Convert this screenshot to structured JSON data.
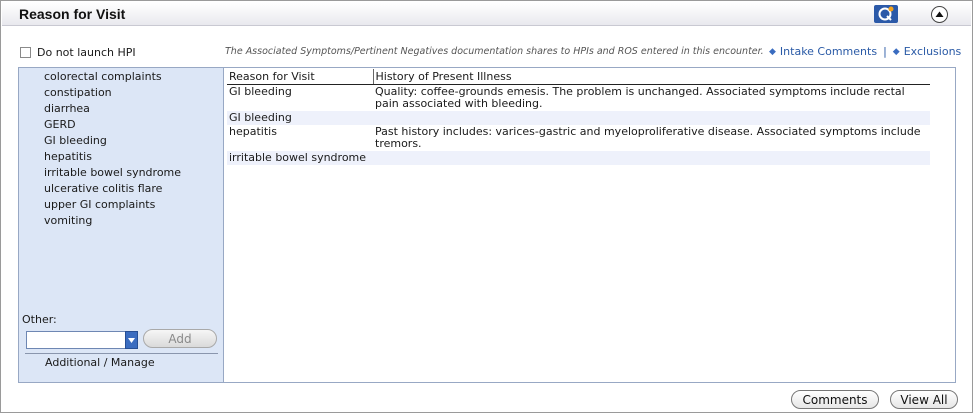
{
  "window": {
    "title": "Reason for Visit"
  },
  "options": {
    "do_not_launch_hpi_label": "Do not launch HPI",
    "note": "The Associated Symptoms/Pertinent Negatives documentation shares to HPIs and ROS entered in this encounter.",
    "intake_comments_label": "Intake Comments",
    "separator": "|",
    "exclusions_label": "Exclusions"
  },
  "left_panel": {
    "complaints": [
      "colorectal complaints",
      "constipation",
      "diarrhea",
      "GERD",
      "GI bleeding",
      "hepatitis",
      "irritable bowel syndrome",
      "ulcerative colitis flare",
      "upper GI complaints",
      "vomiting"
    ],
    "other_label": "Other:",
    "other_value": "",
    "add_label": "Add",
    "additional_label": "Additional / Manage"
  },
  "grid": {
    "columns": [
      "Reason for Visit",
      "History of Present Illness"
    ],
    "rows": [
      {
        "reason": "GI bleeding",
        "hpi": "Quality:  coffee-grounds emesis.  The problem is unchanged.  Associated symptoms include rectal pain associated with bleeding."
      },
      {
        "reason": "GI bleeding",
        "hpi": ""
      },
      {
        "reason": "hepatitis",
        "hpi": "Past history includes: varices-gastric and myeloproliferative disease.  Associated symptoms include tremors."
      },
      {
        "reason": "irritable bowel syndrome",
        "hpi": ""
      }
    ]
  },
  "footer": {
    "comments_label": "Comments",
    "view_all_label": "View All"
  },
  "colors": {
    "panel_bg": "#dce6f6",
    "link": "#2a5aa6",
    "accent": "#3a6cc0"
  },
  "icons": [
    "quick-help-icon",
    "collapse-up-icon",
    "dropdown-arrow-icon",
    "diamond-bullet-icon"
  ]
}
